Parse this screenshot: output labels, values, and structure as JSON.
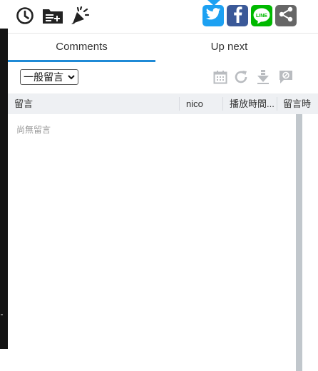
{
  "toolbar": {
    "icons": [
      "history-icon",
      "playlist-add-icon",
      "cheer-icon"
    ],
    "share": [
      {
        "name": "twitter",
        "color": "#1da1f2"
      },
      {
        "name": "facebook",
        "color": "#3b5998"
      },
      {
        "name": "line",
        "color": "#00b900",
        "label": "LINE"
      },
      {
        "name": "share",
        "color": "#666666"
      }
    ]
  },
  "tabs": [
    {
      "label": "Comments",
      "active": true
    },
    {
      "label": "Up next",
      "active": false
    }
  ],
  "filter": {
    "selected": "一般留言",
    "caret": "⌄",
    "actions": [
      "calendar-icon",
      "refresh-icon",
      "download-icon",
      "block-comment-icon"
    ]
  },
  "table": {
    "columns": [
      "留言",
      "nico",
      "播放時間...",
      "留言時"
    ],
    "empty_text": "尚無留言"
  },
  "colors": {
    "accent": "#1f8ad6",
    "header_bg": "#eef0f3"
  }
}
